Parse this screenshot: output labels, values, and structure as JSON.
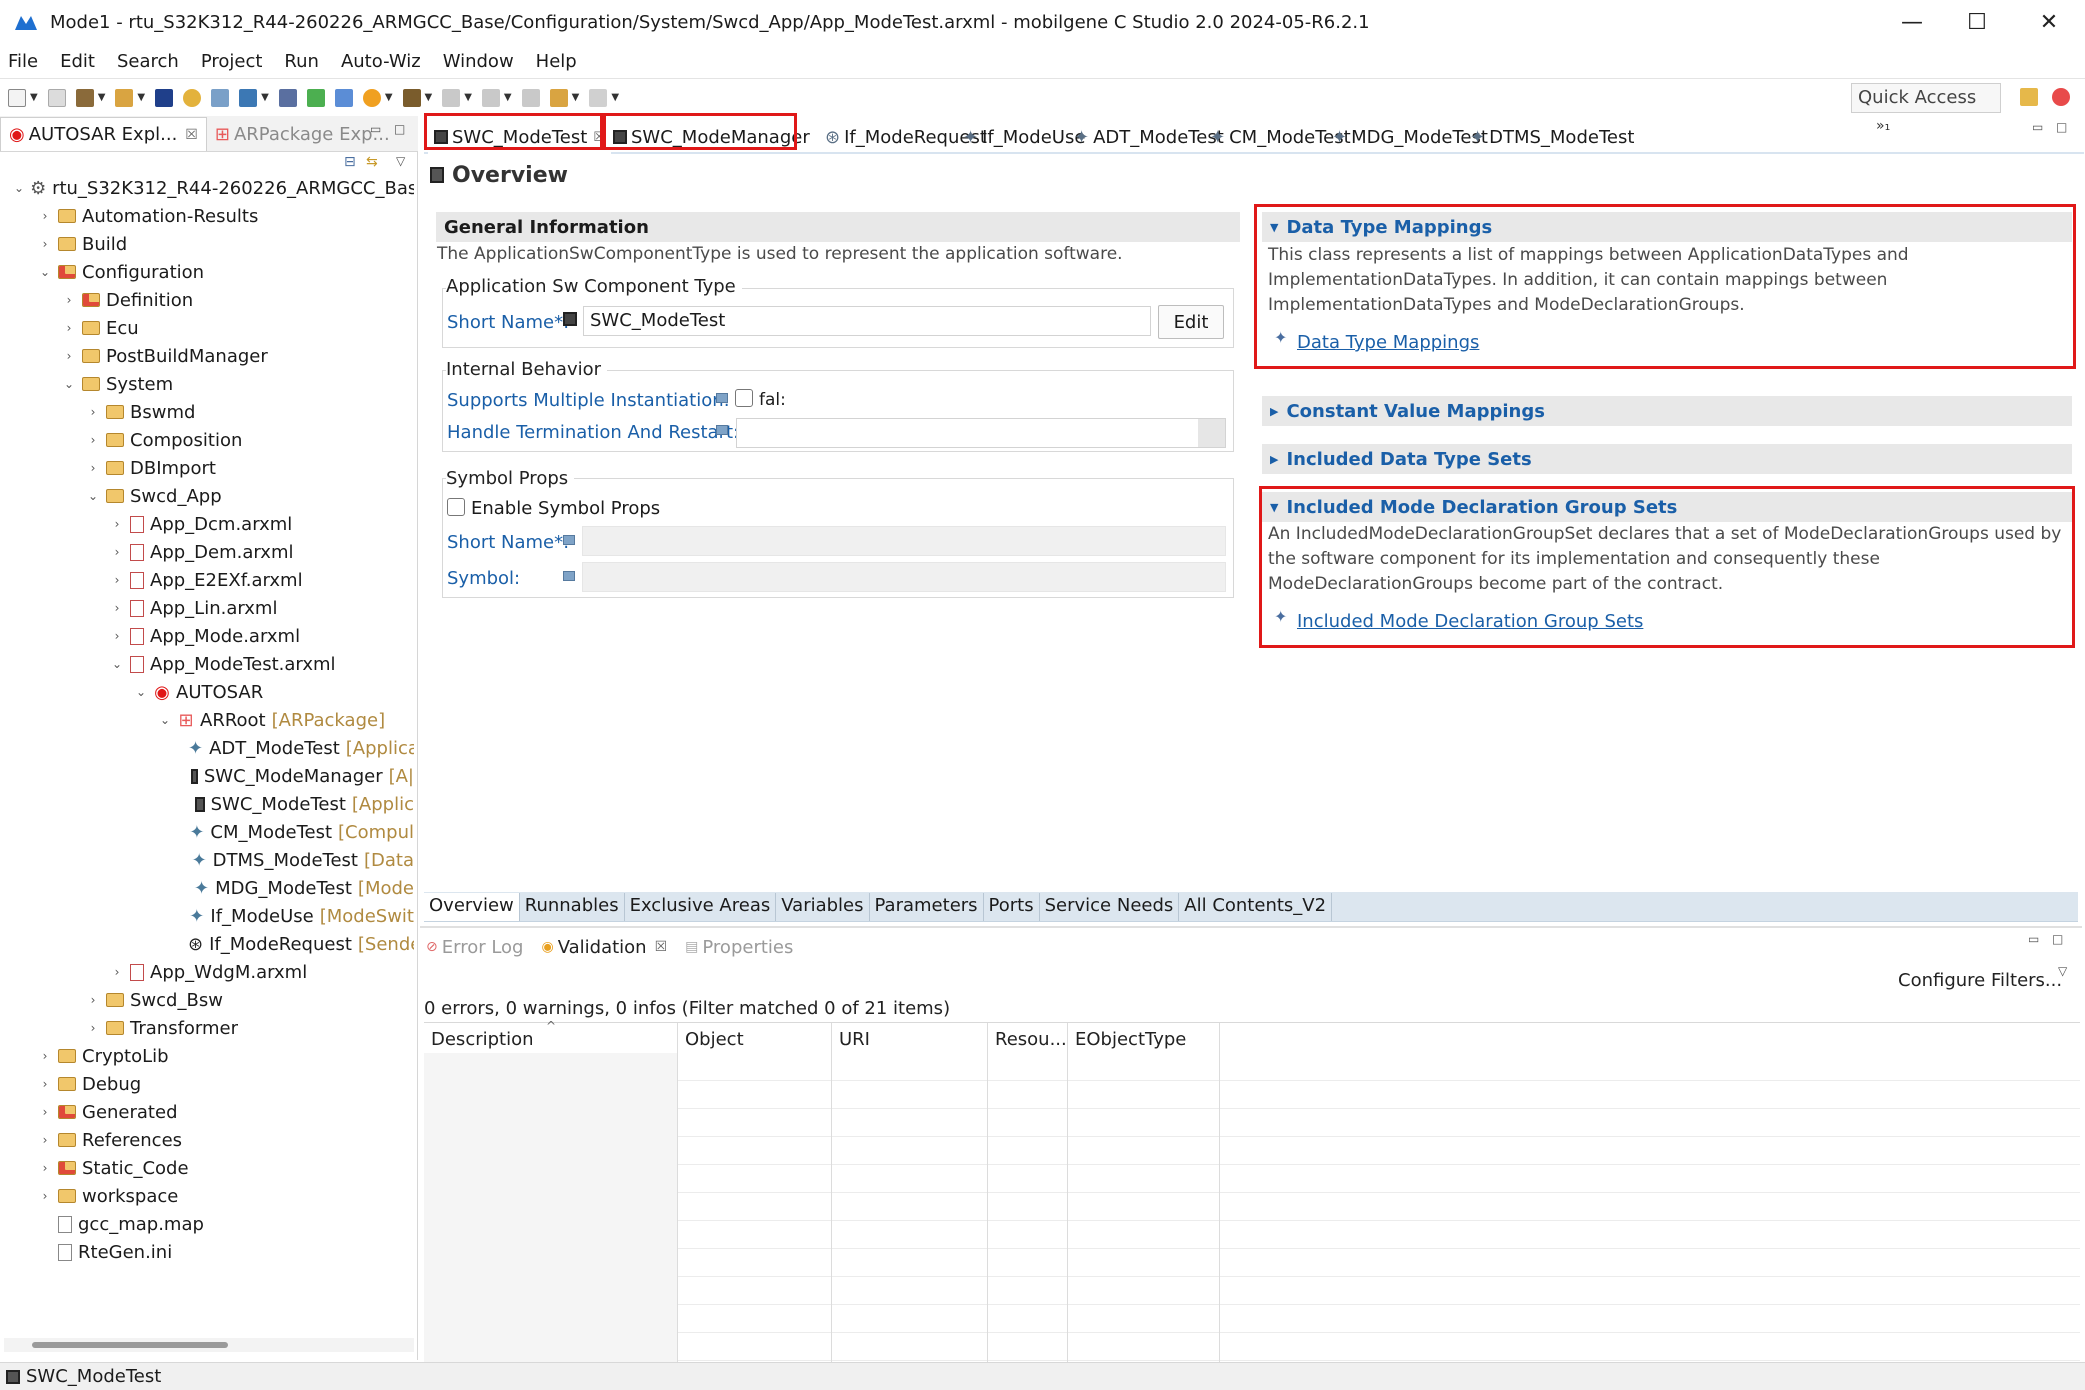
{
  "window": {
    "title": "Mode1 - rtu_S32K312_R44-260226_ARMGCC_Base/Configuration/System/Swcd_App/App_ModeTest.arxml - mobilgene C Studio 2.0 2024-05-R6.2.1",
    "minimize": "—",
    "maximize": "☐",
    "close": "✕"
  },
  "menu": [
    "File",
    "Edit",
    "Search",
    "Project",
    "Run",
    "Auto-Wiz",
    "Window",
    "Help"
  ],
  "toolbar": {
    "quick_access": "Quick Access"
  },
  "left_panel": {
    "tabs": [
      {
        "label": "AUTOSAR Expl...",
        "close": "☒"
      },
      {
        "label": "ARPackage Exp...",
        "close": ""
      }
    ],
    "tree": [
      {
        "label": "rtu_S32K312_R44-260226_ARMGCC_Base",
        "suffix": "",
        "level": 0,
        "arrow": "⌄",
        "icon": "project"
      },
      {
        "label": "Automation-Results",
        "suffix": "",
        "level": 1,
        "arrow": "›",
        "icon": "folder"
      },
      {
        "label": "Build",
        "suffix": "",
        "level": 1,
        "arrow": "›",
        "icon": "folder"
      },
      {
        "label": "Configuration",
        "suffix": "",
        "level": 1,
        "arrow": "⌄",
        "icon": "folder-red"
      },
      {
        "label": "Definition",
        "suffix": "",
        "level": 2,
        "arrow": "›",
        "icon": "folder-red"
      },
      {
        "label": "Ecu",
        "suffix": "",
        "level": 2,
        "arrow": "›",
        "icon": "folder"
      },
      {
        "label": "PostBuildManager",
        "suffix": "",
        "level": 2,
        "arrow": "›",
        "icon": "folder"
      },
      {
        "label": "System",
        "suffix": "",
        "level": 2,
        "arrow": "⌄",
        "icon": "folder"
      },
      {
        "label": "Bswmd",
        "suffix": "",
        "level": 3,
        "arrow": "›",
        "icon": "folder"
      },
      {
        "label": "Composition",
        "suffix": "",
        "level": 3,
        "arrow": "›",
        "icon": "folder"
      },
      {
        "label": "DBImport",
        "suffix": "",
        "level": 3,
        "arrow": "›",
        "icon": "folder"
      },
      {
        "label": "Swcd_App",
        "suffix": "",
        "level": 3,
        "arrow": "⌄",
        "icon": "folder"
      },
      {
        "label": "App_Dcm.arxml",
        "suffix": "",
        "level": 4,
        "arrow": "›",
        "icon": "file"
      },
      {
        "label": "App_Dem.arxml",
        "suffix": "",
        "level": 4,
        "arrow": "›",
        "icon": "file"
      },
      {
        "label": "App_E2EXf.arxml",
        "suffix": "",
        "level": 4,
        "arrow": "›",
        "icon": "file"
      },
      {
        "label": "App_Lin.arxml",
        "suffix": "",
        "level": 4,
        "arrow": "›",
        "icon": "file"
      },
      {
        "label": "App_Mode.arxml",
        "suffix": "",
        "level": 4,
        "arrow": "›",
        "icon": "file"
      },
      {
        "label": "App_ModeTest.arxml",
        "suffix": "",
        "level": 4,
        "arrow": "⌄",
        "icon": "file"
      },
      {
        "label": "AUTOSAR",
        "suffix": "",
        "level": 5,
        "arrow": "⌄",
        "icon": "autosar"
      },
      {
        "label": "ARRoot",
        "suffix": "[ARPackage]",
        "level": 6,
        "arrow": "⌄",
        "icon": "package"
      },
      {
        "label": "ADT_ModeTest",
        "suffix": "[Applica",
        "level": 7,
        "arrow": "",
        "icon": "element"
      },
      {
        "label": "SWC_ModeManager",
        "suffix": "[A|",
        "level": 7,
        "arrow": "",
        "icon": "swc"
      },
      {
        "label": "SWC_ModeTest",
        "suffix": "[Applic",
        "level": 7,
        "arrow": "",
        "icon": "swc"
      },
      {
        "label": "CM_ModeTest",
        "suffix": "[Compul",
        "level": 7,
        "arrow": "",
        "icon": "element"
      },
      {
        "label": "DTMS_ModeTest",
        "suffix": "[Data",
        "level": 7,
        "arrow": "",
        "icon": "element"
      },
      {
        "label": "MDG_ModeTest",
        "suffix": "[Mode",
        "level": 7,
        "arrow": "",
        "icon": "element"
      },
      {
        "label": "If_ModeUse",
        "suffix": "[ModeSwit",
        "level": 7,
        "arrow": "",
        "icon": "element"
      },
      {
        "label": "If_ModeRequest",
        "suffix": "[Sende",
        "level": 7,
        "arrow": "",
        "icon": "sender"
      },
      {
        "label": "App_WdgM.arxml",
        "suffix": "",
        "level": 4,
        "arrow": "›",
        "icon": "file"
      },
      {
        "label": "Swcd_Bsw",
        "suffix": "",
        "level": 3,
        "arrow": "›",
        "icon": "folder"
      },
      {
        "label": "Transformer",
        "suffix": "",
        "level": 3,
        "arrow": "›",
        "icon": "folder"
      },
      {
        "label": "CryptoLib",
        "suffix": "",
        "level": 1,
        "arrow": "›",
        "icon": "folder"
      },
      {
        "label": "Debug",
        "suffix": "",
        "level": 1,
        "arrow": "›",
        "icon": "folder"
      },
      {
        "label": "Generated",
        "suffix": "",
        "level": 1,
        "arrow": "›",
        "icon": "folder-red"
      },
      {
        "label": "References",
        "suffix": "",
        "level": 1,
        "arrow": "›",
        "icon": "folder"
      },
      {
        "label": "Static_Code",
        "suffix": "",
        "level": 1,
        "arrow": "›",
        "icon": "folder-red"
      },
      {
        "label": "workspace",
        "suffix": "",
        "level": 1,
        "arrow": "›",
        "icon": "folder"
      },
      {
        "label": "gcc_map.map",
        "suffix": "",
        "level": 1,
        "arrow": "",
        "icon": "plainfile"
      },
      {
        "label": "RteGen.ini",
        "suffix": "",
        "level": 1,
        "arrow": "",
        "icon": "plainfile"
      }
    ]
  },
  "editor_tabs": [
    {
      "label": "SWC_ModeTest",
      "close": "☒",
      "active": true
    },
    {
      "label": "SWC_ModeManager",
      "close": "",
      "active": false
    },
    {
      "label": "If_ModeRequest",
      "close": "",
      "active": false
    },
    {
      "label": "If_ModeUse",
      "close": "",
      "active": false
    },
    {
      "label": "ADT_ModeTest",
      "close": "",
      "active": false
    },
    {
      "label": "CM_ModeTest",
      "close": "",
      "active": false
    },
    {
      "label": "MDG_ModeTest",
      "close": "",
      "active": false
    },
    {
      "label": "DTMS_ModeTest",
      "close": "",
      "active": false
    }
  ],
  "editor_overflow": "»₁",
  "overview": {
    "title": "Overview",
    "general": {
      "header": "General Information",
      "desc": "The ApplicationSwComponentType is used to represent the application software.",
      "group_label": "Application Sw Component Type",
      "short_name_label": "Short Name*:",
      "short_name_value": "SWC_ModeTest",
      "edit_button": "Edit"
    },
    "internal": {
      "group_label": "Internal Behavior",
      "multi_label": "Supports Multiple Instantiation:",
      "multi_value": "fal:",
      "handle_label": "Handle Termination And Restart:",
      "handle_value": ""
    },
    "symbol": {
      "group_label": "Symbol Props",
      "enable_label": "Enable Symbol Props",
      "short_name_label": "Short Name*:",
      "symbol_label": "Symbol:"
    },
    "right_sections": [
      {
        "title": "Data Type Mappings",
        "expanded": true,
        "desc": "This class represents a list of mappings between ApplicationDataTypes and ImplementationDataTypes. In addition, it can contain mappings between ImplementationDataTypes and ModeDeclarationGroups.",
        "link": "Data Type Mappings"
      },
      {
        "title": "Constant Value Mappings",
        "expanded": false
      },
      {
        "title": "Included Data Type Sets",
        "expanded": false
      },
      {
        "title": "Included Mode Declaration Group Sets",
        "expanded": true,
        "desc": "An IncludedModeDeclarationGroupSet declares that a set of ModeDeclarationGroups used by the software component for its implementation and consequently these ModeDeclarationGroups become part of the contract.",
        "link": "Included Mode Declaration Group Sets"
      }
    ]
  },
  "page_tabs": [
    "Overview",
    "Runnables",
    "Exclusive Areas",
    "Variables",
    "Parameters",
    "Ports",
    "Service Needs",
    "All Contents_V2"
  ],
  "bottom_panel": {
    "tabs": [
      {
        "label": "Error Log",
        "active": false,
        "close": ""
      },
      {
        "label": "Validation",
        "active": true,
        "close": "☒"
      },
      {
        "label": "Properties",
        "active": false,
        "close": ""
      }
    ],
    "configure_filters": "Configure Filters...",
    "status": "0 errors, 0 warnings, 0 infos (Filter matched 0 of 21 items)",
    "columns": [
      "Description",
      "Object",
      "URI",
      "Resou...",
      "EObjectType"
    ]
  },
  "statusbar": {
    "text": "SWC_ModeTest"
  },
  "colors": {
    "highlight": "#e01818",
    "link": "#1a5fa8",
    "section_bg": "#e8e8e8"
  }
}
